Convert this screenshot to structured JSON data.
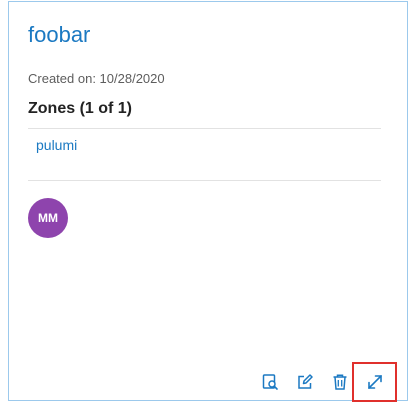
{
  "card": {
    "title": "foobar",
    "created_label": "Created on: ",
    "created_date": "10/28/2020",
    "zones_heading": "Zones (1 of 1)",
    "zones": [
      "pulumi"
    ],
    "avatar_initials": "MM",
    "avatar_color": "#8e44ad",
    "accent_color": "#1b79c2",
    "actions": [
      {
        "icon": "view-details-icon"
      },
      {
        "icon": "edit-icon"
      },
      {
        "icon": "trash-icon"
      },
      {
        "icon": "expand-icon",
        "highlighted": true
      }
    ]
  }
}
